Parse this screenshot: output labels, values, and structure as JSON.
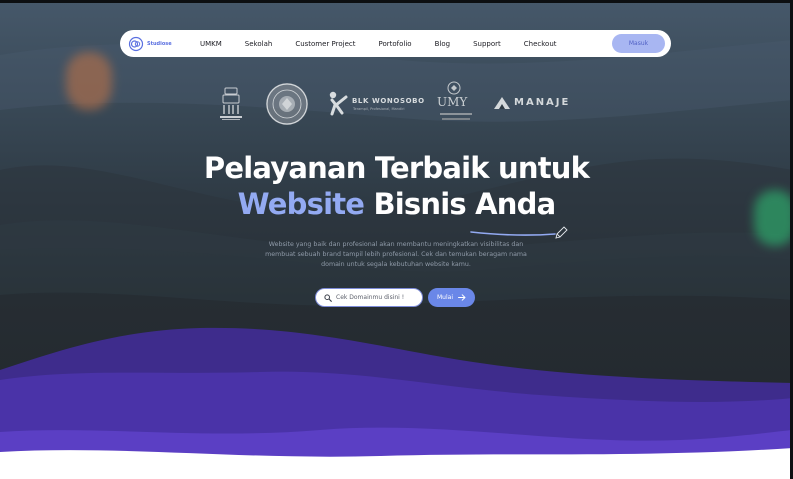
{
  "nav": {
    "logo_text": "Studiose",
    "links": [
      "UMKM",
      "Sekolah",
      "Customer Project",
      "Portofolio",
      "Blog",
      "Support",
      "Checkout"
    ],
    "login_label": "Masuk"
  },
  "partners": {
    "blk_name": "BLK WONOSOBO",
    "blk_tagline": "Terampil, Profesional, Mandiri",
    "umy_name": "UMY",
    "manaje_name": "MANAJE"
  },
  "hero": {
    "title_line1": "Pelayanan Terbaik untuk",
    "title_accent": "Website",
    "title_rest": " Bisnis Anda",
    "description_lines": [
      "Website yang baik dan profesional akan membantu meningkatkan visibilitas dan",
      "membuat sebuah brand tampil lebih profesional. Cek dan temukan beragam nama",
      "domain untuk segala kebutuhan website kamu."
    ],
    "search_placeholder": "Cek Domainmu disini !",
    "cta_label": "Mulai"
  },
  "colors": {
    "accent": "#93aaf2",
    "button": "#6a87e8",
    "wave_purple": "#4f30b0"
  },
  "icons": {
    "search": "search-icon",
    "arrow": "arrow-right-icon",
    "pencil": "pencil-icon"
  }
}
